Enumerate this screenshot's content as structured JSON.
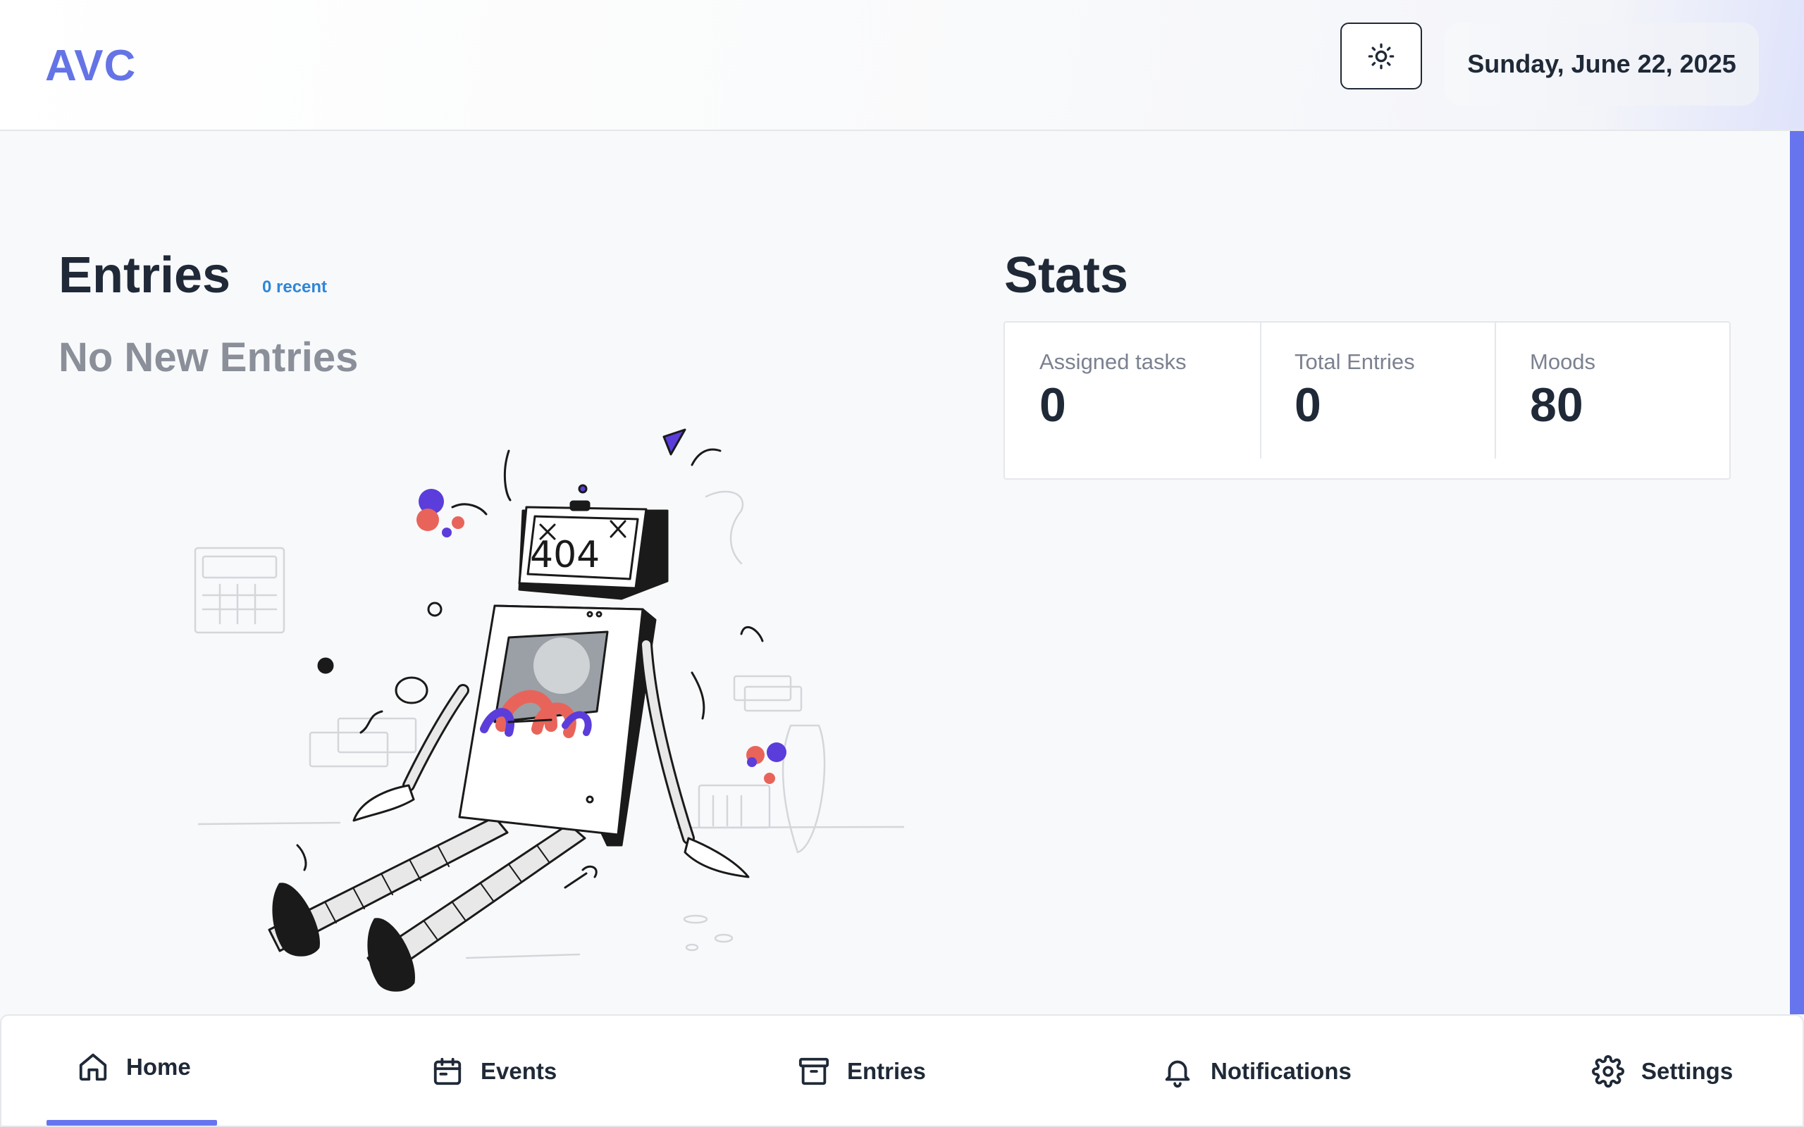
{
  "header": {
    "logo": "AVC",
    "theme_toggle_icon": "sun-icon",
    "date": "Sunday, June 22, 2025"
  },
  "entries": {
    "title": "Entries",
    "recent_badge": "0 recent",
    "empty_message": "No New Entries",
    "illustration": {
      "screen_text": "404"
    }
  },
  "stats": {
    "title": "Stats",
    "items": [
      {
        "label": "Assigned tasks",
        "value": "0"
      },
      {
        "label": "Total Entries",
        "value": "0"
      },
      {
        "label": "Moods",
        "value": "80"
      }
    ]
  },
  "bottom_nav": {
    "active": "Home",
    "items": [
      {
        "label": "Home",
        "icon": "home-icon"
      },
      {
        "label": "Events",
        "icon": "calendar-icon"
      },
      {
        "label": "Entries",
        "icon": "archive-icon"
      },
      {
        "label": "Notifications",
        "icon": "bell-icon"
      },
      {
        "label": "Settings",
        "icon": "gear-icon"
      }
    ]
  },
  "colors": {
    "accent": "#6675ee",
    "logo": "#6474e6",
    "badge": "#2f86d8",
    "muted_text": "#8a8f99",
    "dark_text": "#1f2937"
  }
}
